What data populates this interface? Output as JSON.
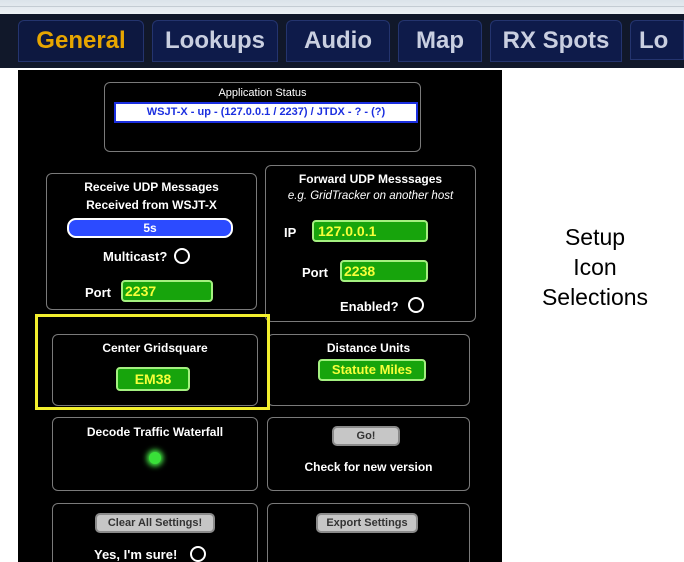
{
  "tabs": [
    {
      "label": "General",
      "active": true
    },
    {
      "label": "Lookups",
      "active": false
    },
    {
      "label": "Audio",
      "active": false
    },
    {
      "label": "Map",
      "active": false
    },
    {
      "label": "RX Spots",
      "active": false
    },
    {
      "label": "Lo",
      "active": false
    }
  ],
  "app_status": {
    "title": "Application Status",
    "value": "WSJT-X - up - (127.0.0.1 / 2237) / JTDX - ? - (?)"
  },
  "receive_udp": {
    "title": "Receive UDP Messages",
    "subtitle": "Received from WSJT-X",
    "age": "5s",
    "multicast_label": "Multicast?",
    "port_label": "Port",
    "port_value": "2237"
  },
  "forward_udp": {
    "title": "Forward UDP Messsages",
    "subtitle": "e.g. GridTracker on another host",
    "ip_label": "IP",
    "ip_value": "127.0.0.1",
    "port_label": "Port",
    "port_value": "2238",
    "enabled_label": "Enabled?"
  },
  "center_gridsquare": {
    "title": "Center Gridsquare",
    "value": "EM38"
  },
  "distance_units": {
    "title": "Distance Units",
    "value": "Statute Miles"
  },
  "decode_waterfall": {
    "title": "Decode Traffic Waterfall"
  },
  "version": {
    "button": "Go!",
    "label": "Check for new version"
  },
  "clear_settings": {
    "button": "Clear All Settings!",
    "confirm_label": "Yes, I'm sure!"
  },
  "export_settings": {
    "button": "Export Settings"
  },
  "side_note": {
    "line1": "Setup",
    "line2": "Icon",
    "line3": "Selections"
  },
  "colors": {
    "panel_bg": "#000000",
    "tab_active_text": "#e7a600",
    "field_green": "#17a40c",
    "field_text": "#f6ff3a",
    "status_blue": "#1b2fe0",
    "highlight_yellow": "#f2ef2e"
  }
}
